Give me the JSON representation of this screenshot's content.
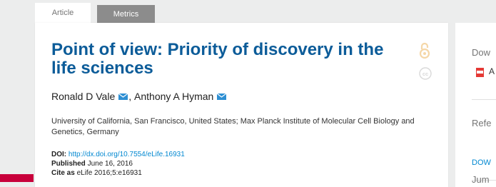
{
  "tabs": [
    {
      "label": "Article",
      "active": true
    },
    {
      "label": "Metrics",
      "active": false
    }
  ],
  "article": {
    "title": "Point of view: Priority of discovery in the life sciences",
    "authors": [
      {
        "name": "Ronald D Vale",
        "separator": ", "
      },
      {
        "name": "Anthony A Hyman",
        "separator": ""
      }
    ],
    "affiliations": "University of California, San Francisco, United States; Max Planck Institute of Molecular Cell Biology and Genetics, Germany",
    "doi_label": "DOI:",
    "doi_link": "http://dx.doi.org/10.7554/eLife.16931",
    "published_label": "Published",
    "published_value": "June 16, 2016",
    "cite_label": "Cite as",
    "cite_value": "eLife 2016;5:e16931"
  },
  "sidebar": {
    "download_heading": "Dow",
    "download_item": "A",
    "references_heading": "Refe",
    "references_link": "DOW",
    "jump_heading": "Jum"
  },
  "colors": {
    "title": "#0c5c99",
    "link": "#0288d1",
    "accent_red": "#c8003b"
  },
  "icons": [
    "open-access-icon",
    "creative-commons-icon",
    "email-icon",
    "pdf-icon"
  ]
}
